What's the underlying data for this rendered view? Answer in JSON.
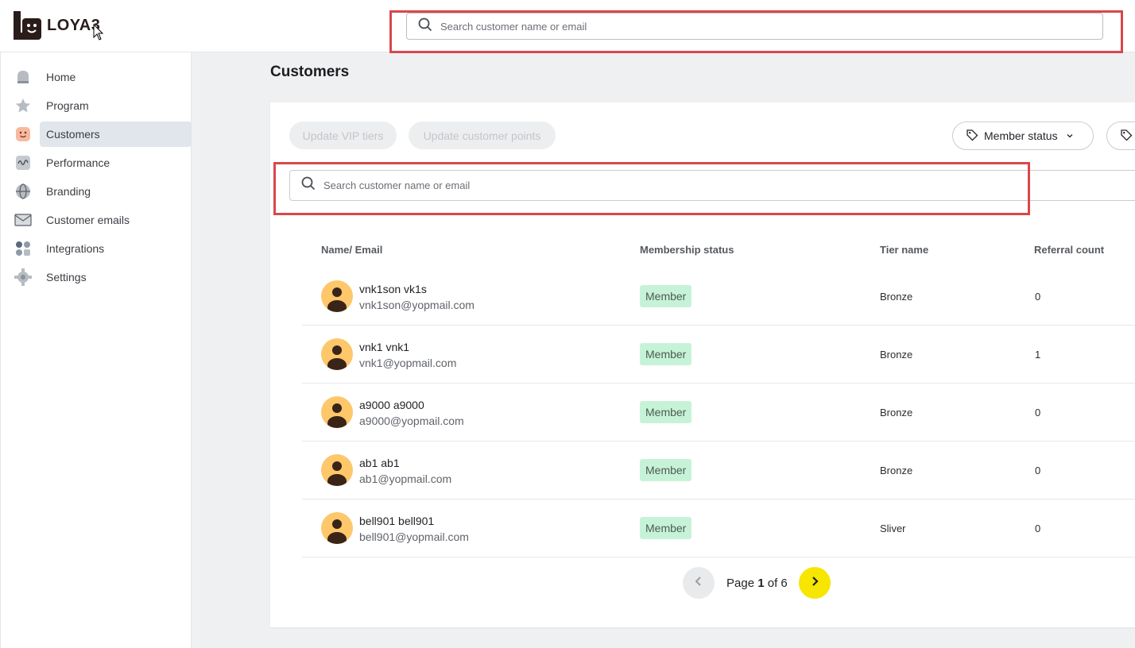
{
  "brand": {
    "name": "LOYA3"
  },
  "header": {
    "search_placeholder": "Search customer name or email"
  },
  "sidebar": {
    "items": [
      {
        "label": "Home",
        "icon": "home-icon"
      },
      {
        "label": "Program",
        "icon": "star-icon"
      },
      {
        "label": "Customers",
        "icon": "smiley-icon",
        "active": true
      },
      {
        "label": "Performance",
        "icon": "wave-icon"
      },
      {
        "label": "Branding",
        "icon": "globe-icon"
      },
      {
        "label": "Customer emails",
        "icon": "mail-icon"
      },
      {
        "label": "Integrations",
        "icon": "grid-icon"
      },
      {
        "label": "Settings",
        "icon": "gear-icon"
      }
    ]
  },
  "main": {
    "title": "Customers",
    "actions": {
      "update_vip": "Update VIP tiers",
      "update_points": "Update customer points"
    },
    "filters": {
      "member_status": "Member status"
    },
    "search_placeholder": "Search customer name or email",
    "table": {
      "headers": {
        "name": "Name/ Email",
        "status": "Membership status",
        "tier": "Tier name",
        "referral": "Referral count"
      },
      "rows": [
        {
          "name": "vnk1son vk1s",
          "email": "vnk1son@yopmail.com",
          "status": "Member",
          "tier": "Bronze",
          "referral": "0"
        },
        {
          "name": "vnk1 vnk1",
          "email": "vnk1@yopmail.com",
          "status": "Member",
          "tier": "Bronze",
          "referral": "1"
        },
        {
          "name": "a9000 a9000",
          "email": "a9000@yopmail.com",
          "status": "Member",
          "tier": "Bronze",
          "referral": "0"
        },
        {
          "name": "ab1 ab1",
          "email": "ab1@yopmail.com",
          "status": "Member",
          "tier": "Bronze",
          "referral": "0"
        },
        {
          "name": "bell901 bell901",
          "email": "bell901@yopmail.com",
          "status": "Member",
          "tier": "Sliver",
          "referral": "0"
        }
      ]
    },
    "pagination": {
      "prefix": "Page",
      "current": "1",
      "separator": "of",
      "total": "6"
    }
  },
  "colors": {
    "highlight": "#d9474b",
    "badge_bg": "#c6f3d8",
    "next_button": "#f7e600",
    "avatar": "#fdc76a"
  }
}
